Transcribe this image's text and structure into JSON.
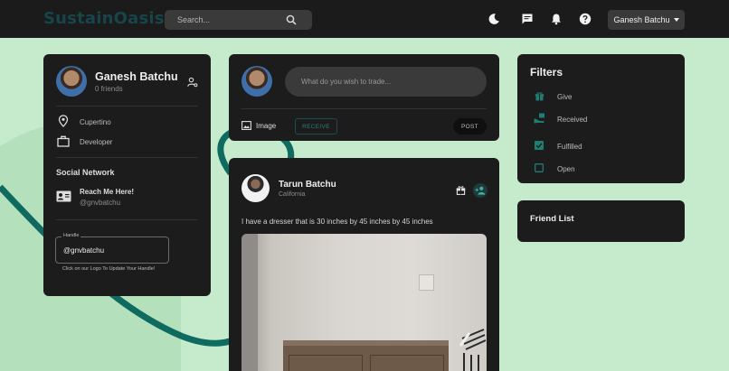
{
  "app": {
    "title": "SustainOasis"
  },
  "search": {
    "placeholder": "Search..."
  },
  "user_menu": {
    "label": "Ganesh Batchu"
  },
  "profile": {
    "name": "Ganesh Batchu",
    "friends": "0 friends",
    "location": "Cupertino",
    "occupation": "Developer",
    "social_title": "Social Network",
    "social_label": "Reach Me Here!",
    "social_handle": "@gnvbatchu",
    "handle_legend": "Handle",
    "handle_value": "@gnvbatchu",
    "handle_hint": "Click on our Logo To Update Your Handle!"
  },
  "composer": {
    "placeholder": "What do you wish to trade...",
    "image_label": "Image",
    "receive_label": "RECEIVE",
    "post_label": "POST"
  },
  "post": {
    "author": "Tarun Batchu",
    "location": "California",
    "text": "I have a dresser that is 30 inches by 45 inches by 45 inches"
  },
  "filters": {
    "title": "Filters",
    "items": [
      {
        "label": "Give",
        "icon": "gift-icon"
      },
      {
        "label": "Received",
        "icon": "hand-receive-icon"
      },
      {
        "label": "Fulfilled",
        "icon": "checkbox-checked-icon",
        "checked": true
      },
      {
        "label": "Open",
        "icon": "checkbox-empty-icon",
        "checked": false
      }
    ]
  },
  "friend_list": {
    "title": "Friend List"
  },
  "colors": {
    "accent": "#2a7f78",
    "logo": "#17454b",
    "background": "#c6ebcc",
    "card": "#1c1c1c",
    "topbar": "#1b1b1b"
  }
}
